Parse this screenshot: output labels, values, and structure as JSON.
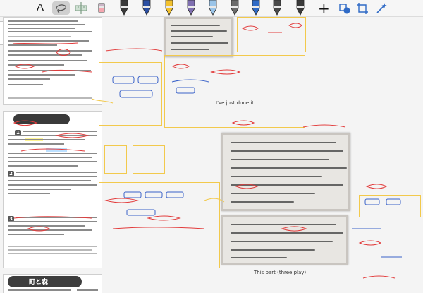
{
  "toolbar": {
    "text_tool_label": "A",
    "add_label": "+",
    "icons": [
      "lasso-icon",
      "ruler-icon",
      "sticker-icon",
      "pen-icon",
      "highlighter-icon",
      "shape-icon",
      "crop-icon",
      "wand-icon"
    ],
    "pen_colors": [
      "#3a3a3a",
      "#2b4fa3",
      "#f2c12e",
      "#7f6fb0",
      "#9ac4e8",
      "#6a6a6a",
      "#2f6ac6",
      "#4a4a4a",
      "#3a3a3a"
    ]
  },
  "nav": {
    "back_label": "‹"
  },
  "pages": {
    "lesson": {
      "title": "町と森"
    },
    "badges": [
      "1",
      "2",
      "3"
    ]
  },
  "annotations": {
    "notes": [
      "I've just done it",
      "This part (three play)"
    ]
  }
}
